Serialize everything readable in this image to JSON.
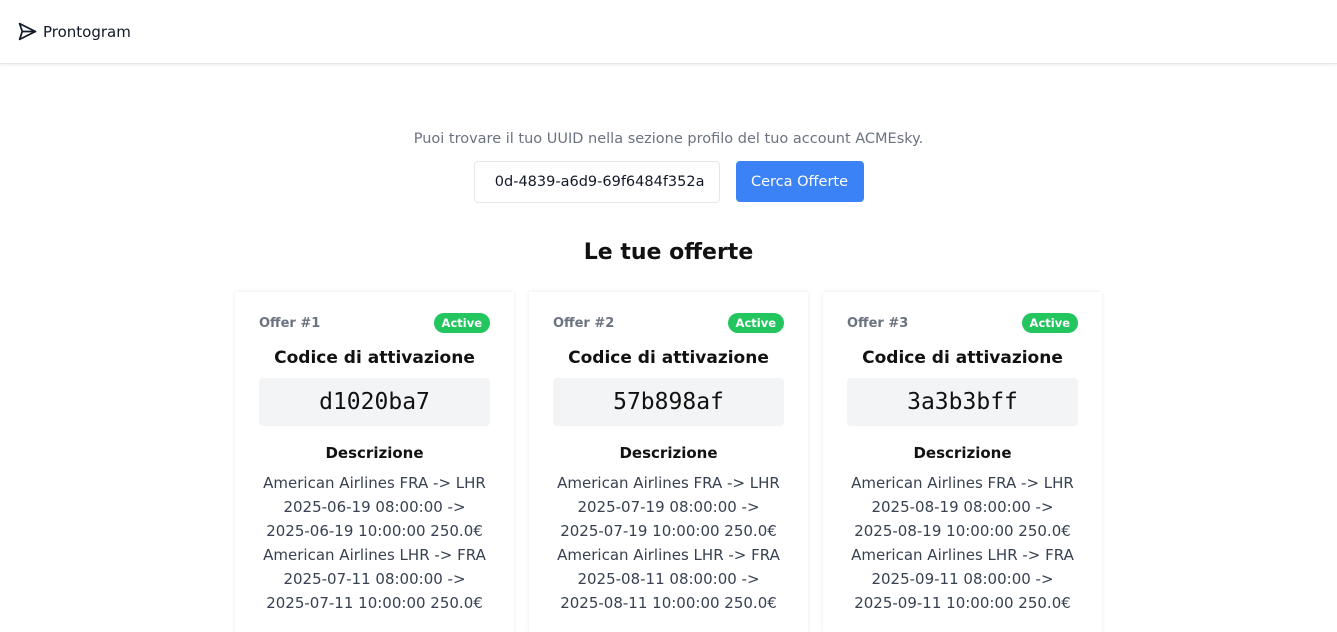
{
  "navbar": {
    "brand": "Prontogram",
    "brand_icon": "paper-plane-icon"
  },
  "search": {
    "hint": "Puoi trovare il tuo UUID nella sezione profilo del tuo account ACMEsky.",
    "uuid_value": "0d-4839-a6d9-69f6484f352a",
    "button_label": "Cerca Offerte"
  },
  "offers_section": {
    "title": "Le tue offerte",
    "code_heading": "Codice di attivazione",
    "description_heading": "Descrizione"
  },
  "colors": {
    "primary_button": "#3b82f6",
    "active_badge": "#22c55e",
    "code_background": "#f3f4f6"
  },
  "offers": [
    {
      "label": "Offer #1",
      "status": "Active",
      "code": "d1020ba7",
      "description_lines": [
        "American Airlines FRA -> LHR",
        "2025-06-19 08:00:00 ->",
        "2025-06-19 10:00:00 250.0€",
        "American Airlines LHR -> FRA",
        "2025-07-11 08:00:00 ->",
        "2025-07-11 10:00:00 250.0€"
      ]
    },
    {
      "label": "Offer #2",
      "status": "Active",
      "code": "57b898af",
      "description_lines": [
        "American Airlines FRA -> LHR",
        "2025-07-19 08:00:00 ->",
        "2025-07-19 10:00:00 250.0€",
        "American Airlines LHR -> FRA",
        "2025-08-11 08:00:00 ->",
        "2025-08-11 10:00:00 250.0€"
      ]
    },
    {
      "label": "Offer #3",
      "status": "Active",
      "code": "3a3b3bff",
      "description_lines": [
        "American Airlines FRA -> LHR",
        "2025-08-19 08:00:00 ->",
        "2025-08-19 10:00:00 250.0€",
        "American Airlines LHR -> FRA",
        "2025-09-11 08:00:00 ->",
        "2025-09-11 10:00:00 250.0€"
      ]
    }
  ]
}
